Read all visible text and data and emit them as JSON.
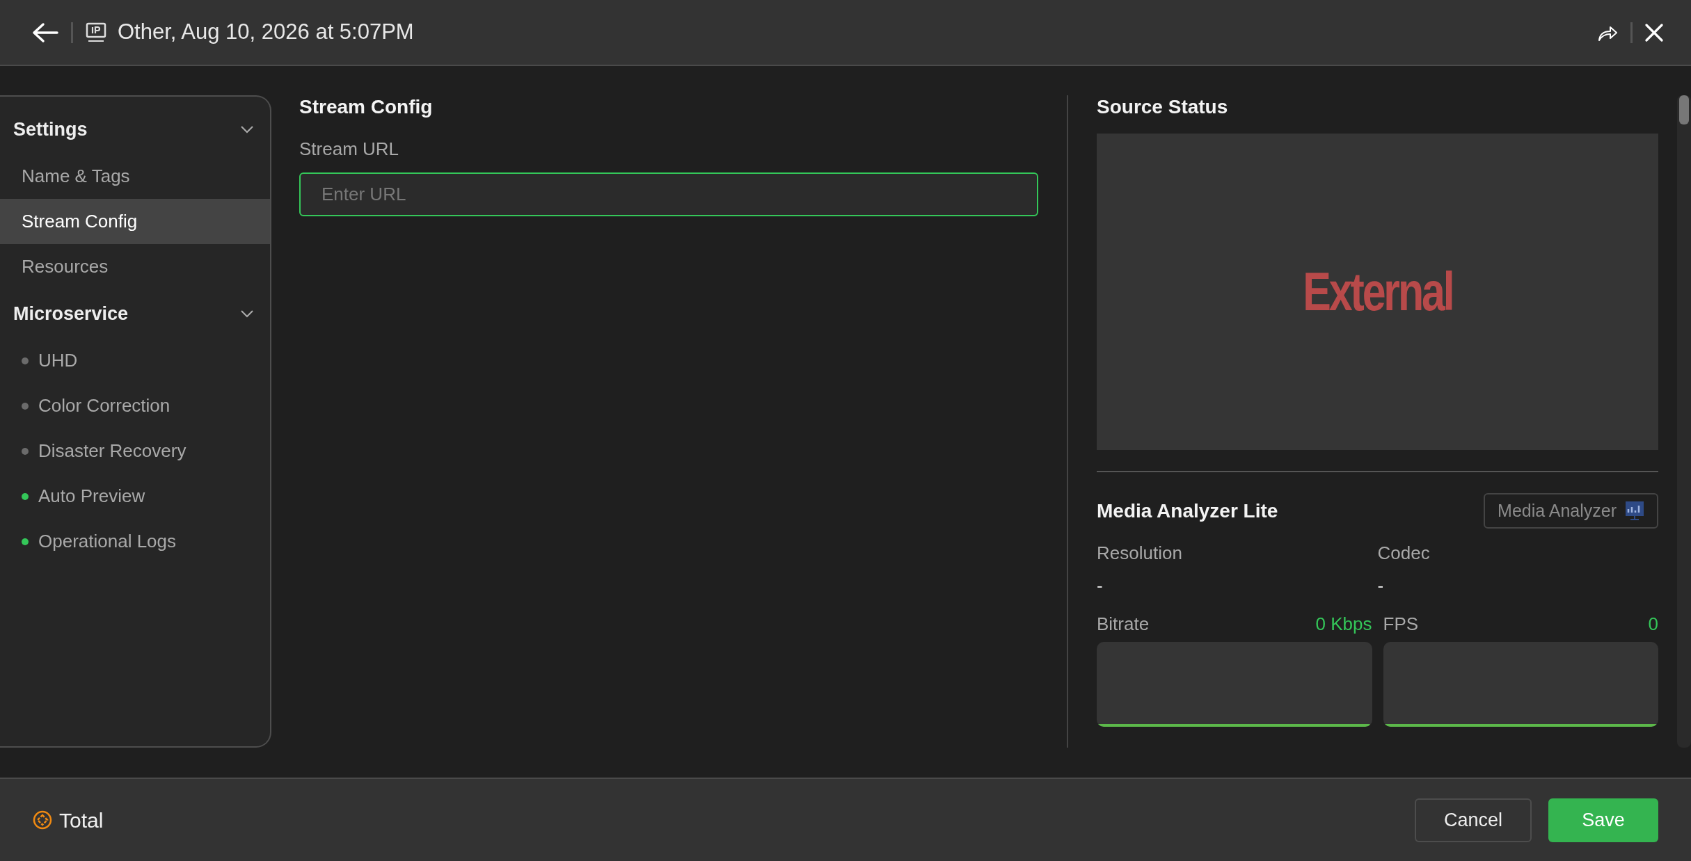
{
  "header": {
    "title": "Other, Aug 10, 2026 at 5:07PM"
  },
  "sidebar": {
    "sections": [
      {
        "label": "Settings",
        "expanded": true,
        "items": [
          {
            "label": "Name & Tags",
            "selected": false
          },
          {
            "label": "Stream Config",
            "selected": true
          },
          {
            "label": "Resources",
            "selected": false
          }
        ]
      },
      {
        "label": "Microservice",
        "expanded": true,
        "items": [
          {
            "label": "UHD",
            "selected": false,
            "color": "#6b6b6b"
          },
          {
            "label": "Color Correction",
            "selected": false,
            "color": "#6b6b6b"
          },
          {
            "label": "Disaster Recovery",
            "selected": false,
            "color": "#6b6b6b"
          },
          {
            "label": "Auto Preview",
            "selected": false,
            "color": "#34c759"
          },
          {
            "label": "Operational Logs",
            "selected": false,
            "color": "#34c759"
          }
        ]
      }
    ]
  },
  "stream_config": {
    "title": "Stream Config",
    "field": {
      "label": "Stream URL",
      "placeholder": "Enter URL",
      "focused": true
    }
  },
  "source_status": {
    "title": "Source Status",
    "preview_label": "External"
  },
  "media_analyzer": {
    "title": "Media Analyzer Lite",
    "button": "Media Analyzer",
    "fields": [
      {
        "label": "Resolution",
        "value": "-"
      },
      {
        "label": "Codec",
        "value": "-"
      }
    ],
    "meters": [
      {
        "label": "Bitrate",
        "value": "0 Kbps"
      },
      {
        "label": "FPS",
        "value": "0"
      }
    ]
  },
  "footer": {
    "total_label": "Total",
    "buttons": [
      {
        "label": "Cancel",
        "kind": "secondary"
      },
      {
        "label": "Save",
        "kind": "primary"
      }
    ]
  }
}
